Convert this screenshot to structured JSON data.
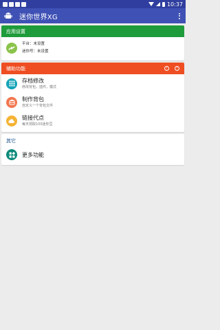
{
  "status_bar": {
    "time": "10:37"
  },
  "app_bar": {
    "title": "迷你世界XG"
  },
  "colors": {
    "primary": "#3f51b5",
    "status": "#303f9f",
    "green": "#1e9b3a",
    "orange": "#ef4e22",
    "teal": "#0b8a7a",
    "cyan": "#16a3b8",
    "salmon": "#f2774f",
    "amber": "#f5b335"
  },
  "app_settings": {
    "header": "应用设置",
    "platform": "平台：未设置",
    "mini_id": "迷你号：未设置"
  },
  "aux": {
    "header": "辅助功能",
    "items": [
      {
        "title": "存档修改",
        "subtitle": "修改背包，插件，模式",
        "icon": "grid-icon"
      },
      {
        "title": "制作背包",
        "subtitle": "自定义一个背包文件",
        "icon": "backpack-icon"
      },
      {
        "title": "链接代点",
        "subtitle": "每天领取100迷你豆",
        "icon": "cloud-icon"
      }
    ]
  },
  "other": {
    "header": "其它",
    "more_label": "更多功能"
  }
}
